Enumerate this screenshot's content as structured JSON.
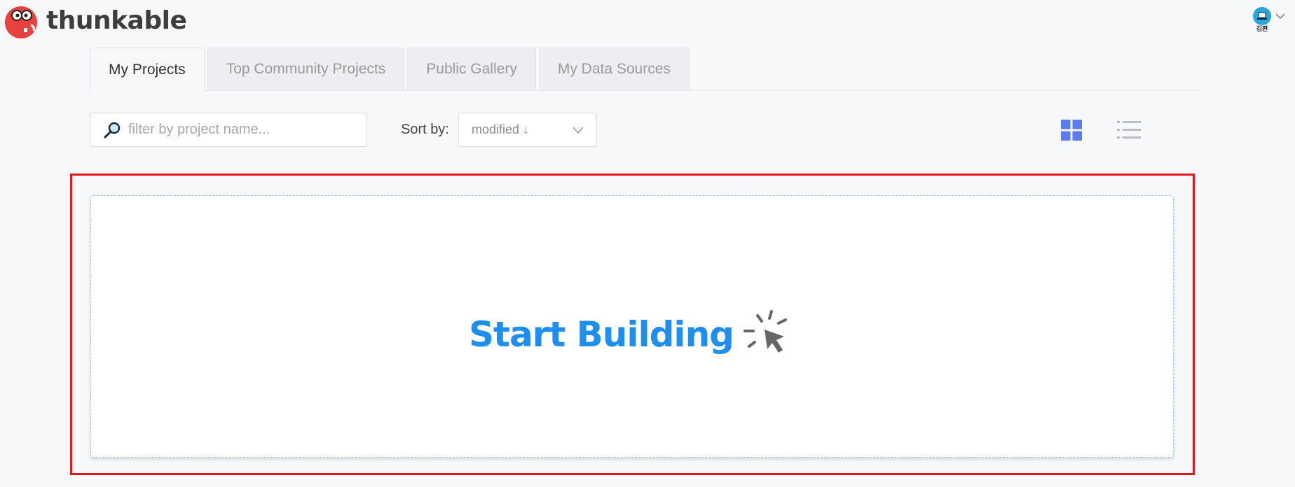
{
  "header": {
    "brand": "thunkable",
    "user_name": "김편"
  },
  "tabs": [
    {
      "label": "My Projects",
      "active": true
    },
    {
      "label": "Top Community Projects",
      "active": false
    },
    {
      "label": "Public Gallery",
      "active": false
    },
    {
      "label": "My Data Sources",
      "active": false
    }
  ],
  "toolbar": {
    "search_placeholder": "filter by project name...",
    "search_value": "",
    "sort_label": "Sort by:",
    "sort_value": "modified ↓",
    "view_mode": "grid"
  },
  "main": {
    "cta_label": "Start Building"
  },
  "colors": {
    "accent": "#1e8fef",
    "grid_icon": "#5a7cf0",
    "highlight": "#e8141c",
    "logo": "#e8413f"
  },
  "icons": [
    "thunkable-logo",
    "avatar",
    "chevron-down-icon",
    "search-icon",
    "grid-view-icon",
    "list-view-icon",
    "click-cursor-icon"
  ]
}
